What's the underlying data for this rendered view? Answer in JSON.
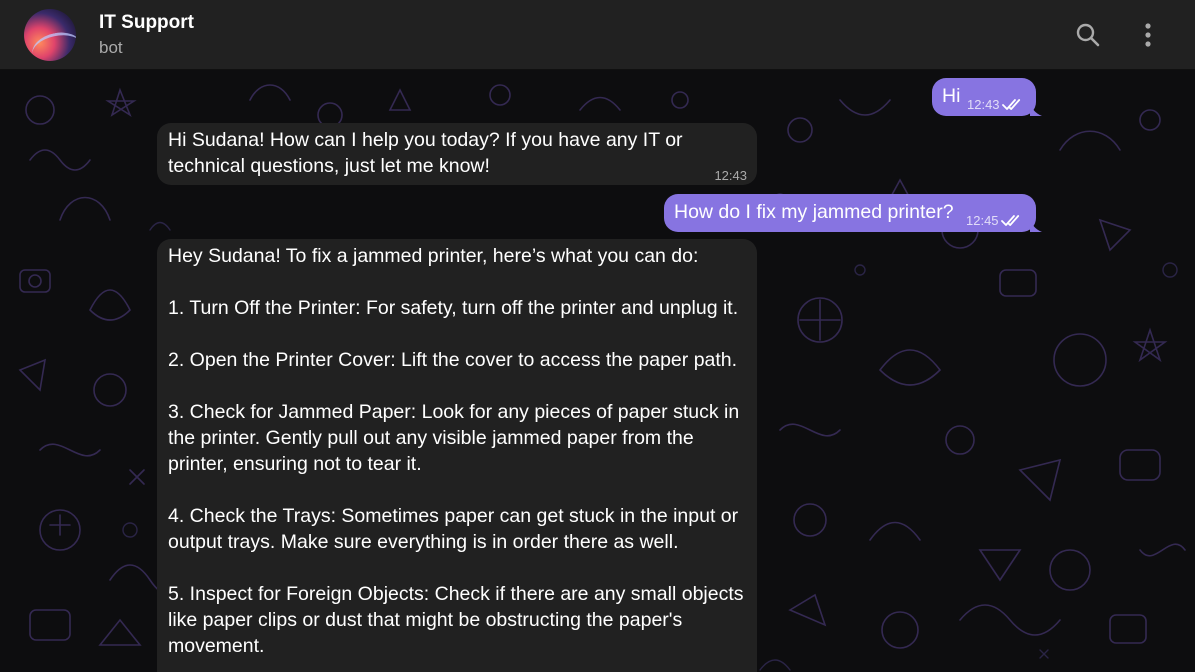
{
  "header": {
    "title": "IT Support",
    "status": "bot"
  },
  "messages": [
    {
      "direction": "out",
      "text": "Hi",
      "time": "12:43",
      "read": true
    },
    {
      "direction": "in",
      "text": "Hi Sudana! How can I help you today? If you have any IT or technical questions, just let me know!",
      "time": "12:43"
    },
    {
      "direction": "out",
      "text": "How do I fix my jammed printer?",
      "time": "12:45",
      "read": true
    },
    {
      "direction": "in",
      "paragraphs": [
        "Hey Sudana! To fix a jammed printer, here’s what you can do:",
        "1. Turn Off the Printer: For safety, turn off the printer and unplug it.",
        "2. Open the Printer Cover: Lift the cover to access the paper path.",
        "3. Check for Jammed Paper: Look for any pieces of paper stuck in the printer. Gently pull out any visible jammed paper from the printer, ensuring not to tear it.",
        "4. Check the Trays: Sometimes paper can get stuck in the input or output trays. Make sure everything is in order there as well.",
        "5. Inspect for Foreign Objects: Check if there are any small objects like paper clips or dust that might be obstructing the paper's movement."
      ]
    }
  ],
  "icons": {
    "search": "search-icon",
    "menu": "more-vertical-icon",
    "read_receipt": "double-check-icon"
  },
  "colors": {
    "header_bg": "#212121",
    "incoming_bubble": "#212121",
    "outgoing_bubble": "#8774e1",
    "chat_bg": "#0d0d0f",
    "doodle_stroke": "#3a2f5a"
  }
}
